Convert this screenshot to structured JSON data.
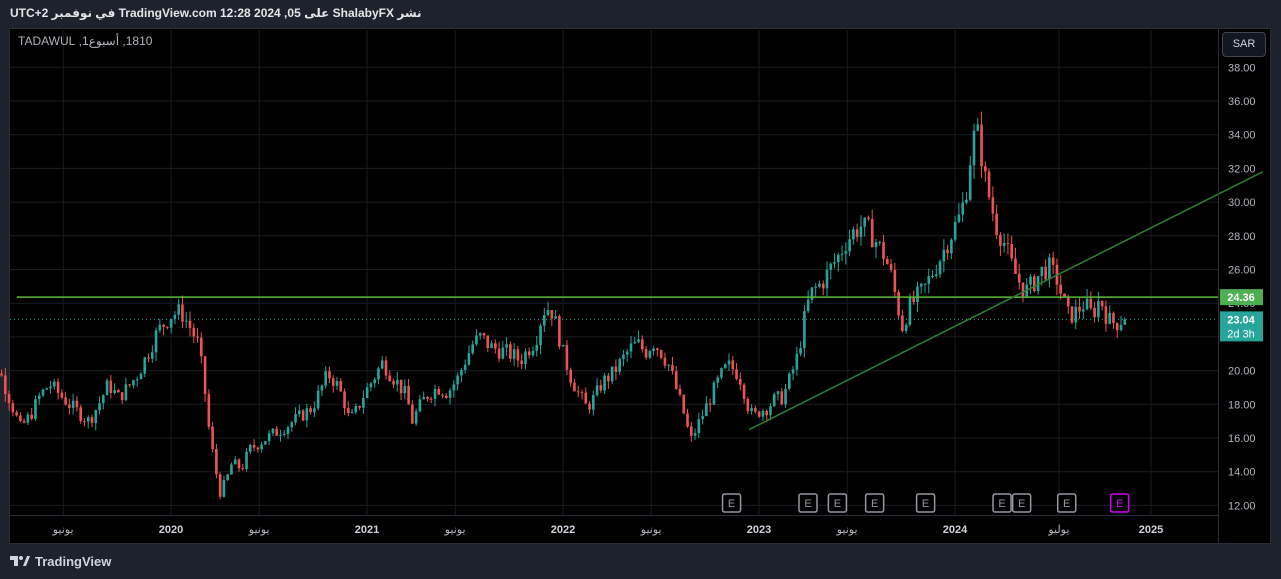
{
  "header": {
    "text": "نشر ShalabyFX على TradingView.com 12:28 2024 ,05 في نوفمبر UTC+2"
  },
  "symbol": {
    "text": "1810, أسبوع1, TADAWUL"
  },
  "currency": "SAR",
  "footer": {
    "brand": "TradingView"
  },
  "colors": {
    "up": "#26a69a",
    "down": "#ef5350",
    "horizontal_line": "#5bbd3c",
    "trend_line": "#2e7d32",
    "price_badge_bg": "#26a69a",
    "level_badge_bg": "#4caf50",
    "earnings_marker": "#9598a1",
    "earnings_marker_active": "#d500f9"
  },
  "chart_data": {
    "type": "candlestick",
    "series_name": "",
    "y_range": [
      11.0,
      39.0
    ],
    "y_ticks": [
      "38.00",
      "36.00",
      "34.00",
      "32.00",
      "30.00",
      "28.00",
      "26.00",
      "24.00",
      "22.00",
      "20.00",
      "18.00",
      "16.00",
      "14.00",
      "12.00"
    ],
    "x_range": [
      2019.02,
      2025.58
    ],
    "x_ticks": [
      {
        "label": "يونيو",
        "t": 2019.45,
        "bold": false
      },
      {
        "label": "2020",
        "t": 2020.0,
        "bold": true
      },
      {
        "label": "يونيو",
        "t": 2020.45,
        "bold": false
      },
      {
        "label": "2021",
        "t": 2021.0,
        "bold": true
      },
      {
        "label": "يونيو",
        "t": 2021.45,
        "bold": false
      },
      {
        "label": "2022",
        "t": 2022.0,
        "bold": true
      },
      {
        "label": "يونيو",
        "t": 2022.45,
        "bold": false
      },
      {
        "label": "2023",
        "t": 2023.0,
        "bold": true
      },
      {
        "label": "يونيو",
        "t": 2023.45,
        "bold": false
      },
      {
        "label": "2024",
        "t": 2024.0,
        "bold": true
      },
      {
        "label": "يوليو",
        "t": 2024.53,
        "bold": false
      },
      {
        "label": "2025",
        "t": 2025.0,
        "bold": true
      }
    ],
    "last_price": {
      "value": 23.04,
      "label": "23.04",
      "countdown": "2d 3h"
    },
    "horizontal_level": {
      "value": 24.36,
      "label": "24.36"
    },
    "trend_line": {
      "start": {
        "t": 2022.95,
        "price": 16.5
      },
      "end": {
        "t": 2025.57,
        "price": 31.8
      }
    },
    "earnings_markers": [
      {
        "t": 2022.86,
        "label": "E",
        "active": false
      },
      {
        "t": 2023.25,
        "label": "E",
        "active": false
      },
      {
        "t": 2023.4,
        "label": "E",
        "active": false
      },
      {
        "t": 2023.59,
        "label": "E",
        "active": false
      },
      {
        "t": 2023.85,
        "label": "E",
        "active": false
      },
      {
        "t": 2024.24,
        "label": "E",
        "active": false
      },
      {
        "t": 2024.34,
        "label": "E",
        "active": false
      },
      {
        "t": 2024.57,
        "label": "E",
        "active": false
      },
      {
        "t": 2024.84,
        "label": "E",
        "active": true
      }
    ],
    "price_path": [
      [
        2019.02,
        19.8
      ],
      [
        2019.05,
        21.0
      ],
      [
        2019.1,
        20.8
      ],
      [
        2019.15,
        19.8
      ],
      [
        2019.2,
        18.2
      ],
      [
        2019.25,
        16.6
      ],
      [
        2019.3,
        17.3
      ],
      [
        2019.35,
        18.5
      ],
      [
        2019.4,
        19.2
      ],
      [
        2019.45,
        18.6
      ],
      [
        2019.5,
        18.0
      ],
      [
        2019.55,
        17.5
      ],
      [
        2019.6,
        17.0
      ],
      [
        2019.65,
        18.0
      ],
      [
        2019.7,
        19.2
      ],
      [
        2019.75,
        18.4
      ],
      [
        2019.8,
        19.0
      ],
      [
        2019.85,
        19.8
      ],
      [
        2019.9,
        21.0
      ],
      [
        2019.95,
        22.3
      ],
      [
        2020.02,
        23.3
      ],
      [
        2020.07,
        23.5
      ],
      [
        2020.12,
        22.5
      ],
      [
        2020.16,
        21.5
      ],
      [
        2020.19,
        19.0
      ],
      [
        2020.21,
        16.8
      ],
      [
        2020.24,
        14.5
      ],
      [
        2020.27,
        12.8
      ],
      [
        2020.3,
        13.4
      ],
      [
        2020.33,
        14.5
      ],
      [
        2020.38,
        14.2
      ],
      [
        2020.42,
        15.3
      ],
      [
        2020.48,
        15.8
      ],
      [
        2020.55,
        16.3
      ],
      [
        2020.62,
        16.8
      ],
      [
        2020.68,
        17.3
      ],
      [
        2020.74,
        17.8
      ],
      [
        2020.78,
        18.8
      ],
      [
        2020.82,
        19.8
      ],
      [
        2020.86,
        19.3
      ],
      [
        2020.9,
        18.3
      ],
      [
        2020.93,
        17.0
      ],
      [
        2020.96,
        17.5
      ],
      [
        2021.0,
        18.5
      ],
      [
        2021.05,
        19.5
      ],
      [
        2021.1,
        20.5
      ],
      [
        2021.14,
        19.8
      ],
      [
        2021.18,
        19.2
      ],
      [
        2021.22,
        18.5
      ],
      [
        2021.25,
        17.0
      ],
      [
        2021.28,
        17.7
      ],
      [
        2021.32,
        18.5
      ],
      [
        2021.38,
        19.0
      ],
      [
        2021.43,
        18.7
      ],
      [
        2021.48,
        19.5
      ],
      [
        2021.52,
        20.6
      ],
      [
        2021.56,
        21.6
      ],
      [
        2021.6,
        22.0
      ],
      [
        2021.65,
        21.4
      ],
      [
        2021.7,
        21.2
      ],
      [
        2021.75,
        21.0
      ],
      [
        2021.8,
        20.6
      ],
      [
        2021.85,
        21.4
      ],
      [
        2021.88,
        21.8
      ],
      [
        2021.9,
        22.8
      ],
      [
        2021.93,
        23.8
      ],
      [
        2021.96,
        23.6
      ],
      [
        2021.99,
        22.5
      ],
      [
        2022.02,
        21.0
      ],
      [
        2022.06,
        19.6
      ],
      [
        2022.1,
        18.6
      ],
      [
        2022.14,
        17.8
      ],
      [
        2022.18,
        18.4
      ],
      [
        2022.22,
        19.3
      ],
      [
        2022.27,
        19.8
      ],
      [
        2022.32,
        20.6
      ],
      [
        2022.36,
        21.3
      ],
      [
        2022.4,
        21.6
      ],
      [
        2022.44,
        21.1
      ],
      [
        2022.48,
        21.7
      ],
      [
        2022.52,
        21.1
      ],
      [
        2022.56,
        20.3
      ],
      [
        2022.6,
        18.8
      ],
      [
        2022.64,
        17.3
      ],
      [
        2022.67,
        15.8
      ],
      [
        2022.7,
        16.6
      ],
      [
        2022.74,
        17.6
      ],
      [
        2022.78,
        18.6
      ],
      [
        2022.82,
        19.6
      ],
      [
        2022.86,
        20.3
      ],
      [
        2022.9,
        20.0
      ],
      [
        2022.93,
        19.4
      ],
      [
        2022.96,
        18.0
      ],
      [
        2022.99,
        17.2
      ],
      [
        2023.02,
        17.6
      ],
      [
        2023.06,
        17.8
      ],
      [
        2023.1,
        18.3
      ],
      [
        2023.14,
        18.4
      ],
      [
        2023.18,
        19.6
      ],
      [
        2023.22,
        21.0
      ],
      [
        2023.25,
        23.0
      ],
      [
        2023.28,
        24.5
      ],
      [
        2023.31,
        24.9
      ],
      [
        2023.34,
        25.2
      ],
      [
        2023.38,
        26.0
      ],
      [
        2023.42,
        26.7
      ],
      [
        2023.46,
        27.6
      ],
      [
        2023.5,
        28.2
      ],
      [
        2023.54,
        28.6
      ],
      [
        2023.58,
        28.3
      ],
      [
        2023.62,
        27.6
      ],
      [
        2023.66,
        26.8
      ],
      [
        2023.69,
        25.8
      ],
      [
        2023.72,
        24.2
      ],
      [
        2023.75,
        22.6
      ],
      [
        2023.78,
        23.6
      ],
      [
        2023.82,
        24.3
      ],
      [
        2023.86,
        24.8
      ],
      [
        2023.9,
        25.7
      ],
      [
        2023.94,
        26.6
      ],
      [
        2023.98,
        27.6
      ],
      [
        2024.02,
        28.6
      ],
      [
        2024.05,
        29.3
      ],
      [
        2024.08,
        31.0
      ],
      [
        2024.11,
        33.8
      ],
      [
        2024.14,
        34.0
      ],
      [
        2024.17,
        31.5
      ],
      [
        2024.2,
        30.0
      ],
      [
        2024.23,
        28.6
      ],
      [
        2024.27,
        27.6
      ],
      [
        2024.31,
        26.2
      ],
      [
        2024.34,
        25.4
      ],
      [
        2024.38,
        24.7
      ],
      [
        2024.42,
        25.2
      ],
      [
        2024.46,
        25.9
      ],
      [
        2024.5,
        26.1
      ],
      [
        2024.54,
        25.4
      ],
      [
        2024.57,
        24.2
      ],
      [
        2024.6,
        23.2
      ],
      [
        2024.64,
        23.5
      ],
      [
        2024.68,
        24.0
      ],
      [
        2024.72,
        23.3
      ],
      [
        2024.76,
        24.3
      ],
      [
        2024.8,
        23.0
      ],
      [
        2024.84,
        22.8
      ],
      [
        2024.87,
        23.04
      ]
    ]
  }
}
